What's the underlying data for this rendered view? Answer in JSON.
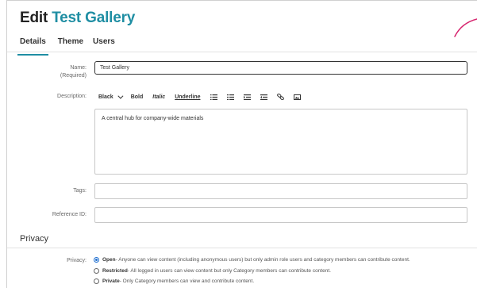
{
  "header": {
    "title_prefix": "Edit",
    "title_name": "Test Gallery"
  },
  "tabs": [
    {
      "label": "Details",
      "active": true
    },
    {
      "label": "Theme",
      "active": false
    },
    {
      "label": "Users",
      "active": false
    }
  ],
  "form": {
    "name_label": "Name:",
    "name_required": "(Required)",
    "name_value": "Test Gallery",
    "description_label": "Description:",
    "description_value": "A central hub for company-wide materials",
    "tags_label": "Tags:",
    "tags_value": "",
    "reference_label": "Reference ID:",
    "reference_value": ""
  },
  "toolbar": {
    "color": "Black",
    "bold": "Bold",
    "italic": "Italic",
    "underline": "Underline",
    "icons": [
      "list-icon",
      "numbered-list-icon",
      "indent-icon",
      "outdent-icon",
      "link-icon",
      "image-icon"
    ]
  },
  "privacy": {
    "section_title": "Privacy",
    "label": "Privacy:",
    "options": [
      {
        "name": "Open",
        "desc": " - Anyone can view content (including anonymous users) but only admin role users and category members can contribute content.",
        "checked": true
      },
      {
        "name": "Restricted",
        "desc": " - All logged in users can view content but only Category members can contribute content.",
        "checked": false
      },
      {
        "name": "Private",
        "desc": " - Only Category members can view and contribute content.",
        "checked": false
      }
    ]
  },
  "colors": {
    "accent": "#1f8ea3",
    "swoosh": "#d6246e",
    "radio": "#1f6fd0"
  }
}
